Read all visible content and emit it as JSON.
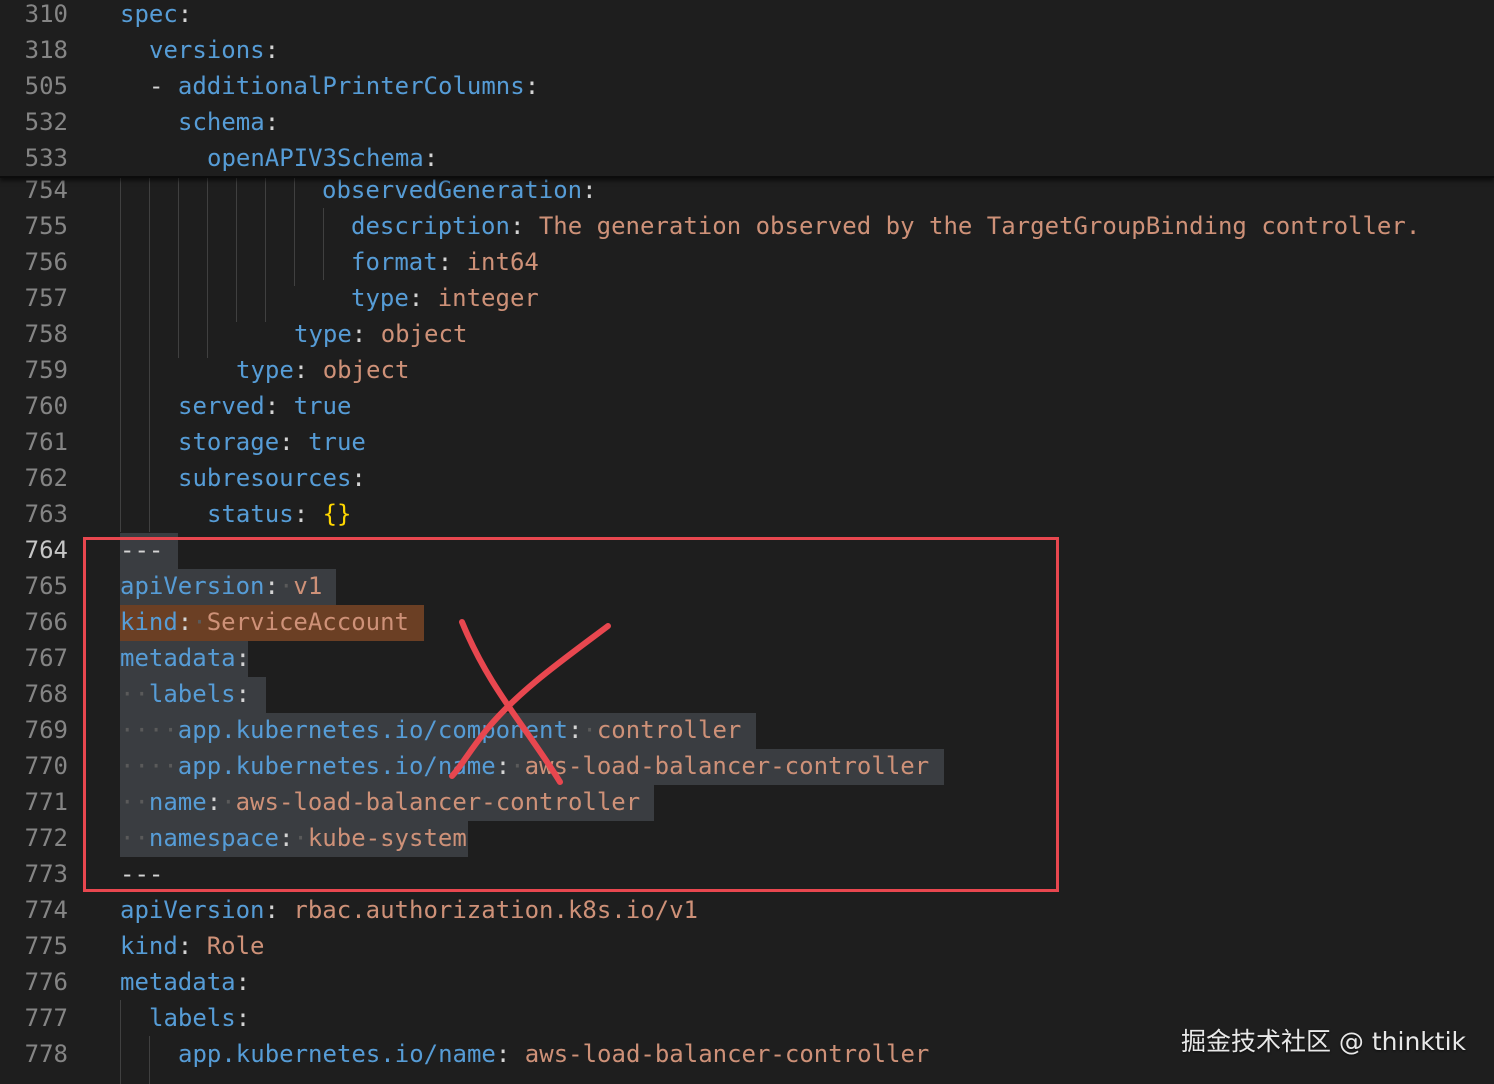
{
  "sticky_lines": [
    {
      "num": "310",
      "tokens": [
        {
          "t": "spec",
          "c": "k"
        },
        {
          "t": ":",
          "c": "p"
        }
      ]
    },
    {
      "num": "318",
      "tokens": [
        {
          "t": "versions",
          "c": "k"
        },
        {
          "t": ":",
          "c": "p"
        }
      ]
    },
    {
      "num": "505",
      "tokens": [
        {
          "t": "- ",
          "c": "p"
        },
        {
          "t": "additionalPrinterColumns",
          "c": "k"
        },
        {
          "t": ":",
          "c": "p"
        }
      ]
    },
    {
      "num": "532",
      "tokens": [
        {
          "t": "schema",
          "c": "k"
        },
        {
          "t": ":",
          "c": "p"
        }
      ]
    },
    {
      "num": "533",
      "tokens": [
        {
          "t": "openAPIV3Schema",
          "c": "k"
        },
        {
          "t": ":",
          "c": "p"
        }
      ]
    }
  ],
  "lines": [
    {
      "num": "754",
      "tokens": [
        {
          "t": "observedGeneration",
          "c": "k"
        },
        {
          "t": ":",
          "c": "p"
        }
      ]
    },
    {
      "num": "755",
      "tokens": [
        {
          "t": "description",
          "c": "k"
        },
        {
          "t": ": ",
          "c": "p"
        },
        {
          "t": "The generation observed by the TargetGroupBinding controller.",
          "c": "v"
        }
      ]
    },
    {
      "num": "756",
      "tokens": [
        {
          "t": "format",
          "c": "k"
        },
        {
          "t": ": ",
          "c": "p"
        },
        {
          "t": "int64",
          "c": "v"
        }
      ]
    },
    {
      "num": "757",
      "tokens": [
        {
          "t": "type",
          "c": "k"
        },
        {
          "t": ": ",
          "c": "p"
        },
        {
          "t": "integer",
          "c": "v"
        }
      ]
    },
    {
      "num": "758",
      "tokens": [
        {
          "t": "type",
          "c": "k"
        },
        {
          "t": ": ",
          "c": "p"
        },
        {
          "t": "object",
          "c": "v"
        }
      ]
    },
    {
      "num": "759",
      "tokens": [
        {
          "t": "type",
          "c": "k"
        },
        {
          "t": ": ",
          "c": "p"
        },
        {
          "t": "object",
          "c": "v"
        }
      ]
    },
    {
      "num": "760",
      "tokens": [
        {
          "t": "served",
          "c": "k"
        },
        {
          "t": ": ",
          "c": "p"
        },
        {
          "t": "true",
          "c": "k"
        }
      ]
    },
    {
      "num": "761",
      "tokens": [
        {
          "t": "storage",
          "c": "k"
        },
        {
          "t": ": ",
          "c": "p"
        },
        {
          "t": "true",
          "c": "k"
        }
      ]
    },
    {
      "num": "762",
      "tokens": [
        {
          "t": "subresources",
          "c": "k"
        },
        {
          "t": ":",
          "c": "p"
        }
      ]
    },
    {
      "num": "763",
      "tokens": [
        {
          "t": "status",
          "c": "k"
        },
        {
          "t": ": ",
          "c": "p"
        },
        {
          "t": "{}",
          "c": "b"
        }
      ]
    },
    {
      "num": "764",
      "active": true,
      "tokens": [
        {
          "t": "---",
          "c": "p"
        }
      ]
    },
    {
      "num": "765",
      "tokens": [
        {
          "t": "apiVersion",
          "c": "k"
        },
        {
          "t": ":",
          "c": "p"
        },
        {
          "t": "·",
          "c": "ws"
        },
        {
          "t": "v1",
          "c": "v"
        }
      ]
    },
    {
      "num": "766",
      "tokens": [
        {
          "t": "kind",
          "c": "k"
        },
        {
          "t": ":",
          "c": "p"
        },
        {
          "t": "·",
          "c": "ws"
        },
        {
          "t": "ServiceAccount",
          "c": "v"
        }
      ]
    },
    {
      "num": "767",
      "tokens": [
        {
          "t": "metadata",
          "c": "k"
        },
        {
          "t": ":",
          "c": "p"
        }
      ]
    },
    {
      "num": "768",
      "tokens": [
        {
          "t": "··",
          "c": "ws"
        },
        {
          "t": "labels",
          "c": "k"
        },
        {
          "t": ":",
          "c": "p"
        }
      ]
    },
    {
      "num": "769",
      "tokens": [
        {
          "t": "····",
          "c": "ws"
        },
        {
          "t": "app.kubernetes.io/component",
          "c": "k"
        },
        {
          "t": ":",
          "c": "p"
        },
        {
          "t": "·",
          "c": "ws"
        },
        {
          "t": "controller",
          "c": "v"
        }
      ]
    },
    {
      "num": "770",
      "tokens": [
        {
          "t": "····",
          "c": "ws"
        },
        {
          "t": "app.kubernetes.io/name",
          "c": "k"
        },
        {
          "t": ":",
          "c": "p"
        },
        {
          "t": "·",
          "c": "ws"
        },
        {
          "t": "aws-load-balancer-controller",
          "c": "v"
        }
      ]
    },
    {
      "num": "771",
      "tokens": [
        {
          "t": "··",
          "c": "ws"
        },
        {
          "t": "name",
          "c": "k"
        },
        {
          "t": ":",
          "c": "p"
        },
        {
          "t": "·",
          "c": "ws"
        },
        {
          "t": "aws-load-balancer-controller",
          "c": "v"
        }
      ]
    },
    {
      "num": "772",
      "tokens": [
        {
          "t": "··",
          "c": "ws"
        },
        {
          "t": "namespace",
          "c": "k"
        },
        {
          "t": ":",
          "c": "p"
        },
        {
          "t": "·",
          "c": "ws"
        },
        {
          "t": "kube-system",
          "c": "v"
        }
      ]
    },
    {
      "num": "773",
      "tokens": [
        {
          "t": "---",
          "c": "p"
        }
      ]
    },
    {
      "num": "774",
      "tokens": [
        {
          "t": "apiVersion",
          "c": "k"
        },
        {
          "t": ": ",
          "c": "p"
        },
        {
          "t": "rbac.authorization.k8s.io/v1",
          "c": "v"
        }
      ]
    },
    {
      "num": "775",
      "tokens": [
        {
          "t": "kind",
          "c": "k"
        },
        {
          "t": ": ",
          "c": "p"
        },
        {
          "t": "Role",
          "c": "v"
        }
      ]
    },
    {
      "num": "776",
      "tokens": [
        {
          "t": "metadata",
          "c": "k"
        },
        {
          "t": ":",
          "c": "p"
        }
      ]
    },
    {
      "num": "777",
      "tokens": [
        {
          "t": "labels",
          "c": "k"
        },
        {
          "t": ":",
          "c": "p"
        }
      ]
    },
    {
      "num": "778",
      "tokens": [
        {
          "t": "app.kubernetes.io/name",
          "c": "k"
        },
        {
          "t": ": ",
          "c": "p"
        },
        {
          "t": "aws-load-balancer-controller",
          "c": "v"
        }
      ]
    }
  ],
  "colors": {
    "background": "#1e1e1e",
    "key": "#569cd6",
    "value": "#ce9178",
    "bracket": "#ffd700",
    "annotation": "#e8474f"
  },
  "watermark": "掘金技术社区 @ thinktik"
}
